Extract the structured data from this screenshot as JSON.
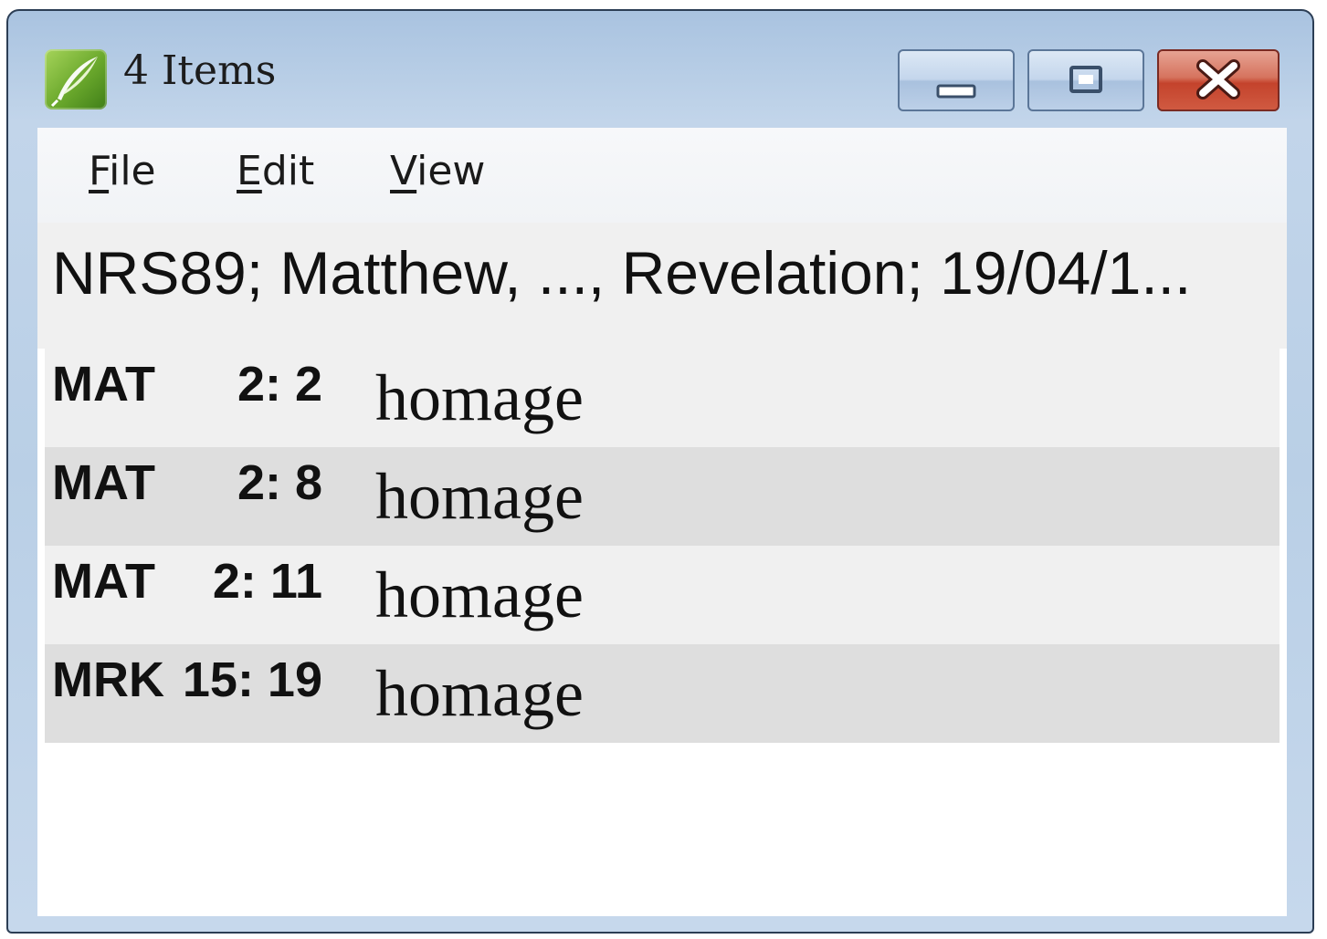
{
  "window": {
    "title": "4 Items",
    "icon": "quill-icon"
  },
  "caption_buttons": {
    "minimize": "minimize-icon",
    "maximize": "maximize-icon",
    "close": "close-icon"
  },
  "menu": {
    "items": [
      {
        "label_first": "F",
        "label_rest": "ile"
      },
      {
        "label_first": "E",
        "label_rest": "dit"
      },
      {
        "label_first": "V",
        "label_rest": "iew"
      }
    ]
  },
  "info": {
    "text": "NRS89; Matthew, ..., Revelation; 19/04/1..."
  },
  "results": [
    {
      "book": "MAT",
      "ref": "2: 2",
      "word": "homage"
    },
    {
      "book": "MAT",
      "ref": "2: 8",
      "word": "homage"
    },
    {
      "book": "MAT",
      "ref": "2: 11",
      "word": "homage"
    },
    {
      "book": "MRK",
      "ref": "15: 19",
      "word": "homage"
    }
  ],
  "colors": {
    "row": "#f0f0f0",
    "row_alt": "#dedede",
    "close_button": "#c4432c"
  }
}
